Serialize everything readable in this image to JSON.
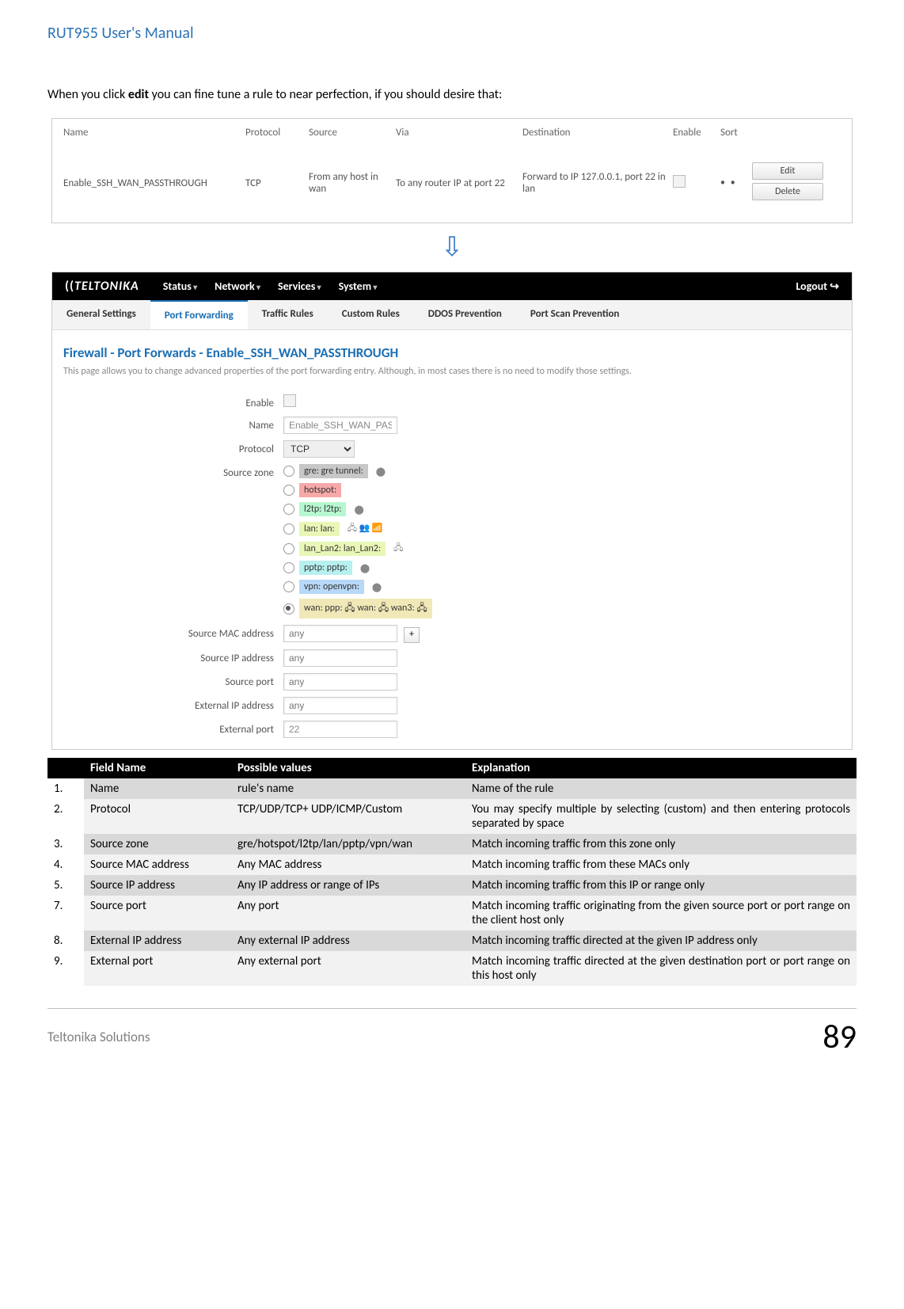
{
  "doc": {
    "header": "RUT955 User's Manual",
    "intro_prefix": "When you click ",
    "intro_bold": "edit",
    "intro_suffix": " you can fine tune a rule to near perfection, if you should desire that:",
    "footer_left": "Teltonika Solutions",
    "page_number": "89"
  },
  "rules_table": {
    "headers": {
      "name": "Name",
      "protocol": "Protocol",
      "source": "Source",
      "via": "Via",
      "destination": "Destination",
      "enable": "Enable",
      "sort": "Sort"
    },
    "row": {
      "name": "Enable_SSH_WAN_PASSTHROUGH",
      "protocol": "TCP",
      "source": "From any host in wan",
      "via": "To any router IP at port 22",
      "destination": "Forward to IP 127.0.0.1, port 22 in lan",
      "sort_dots": "• •",
      "edit": "Edit",
      "delete": "Delete"
    }
  },
  "nav": {
    "logo": "TELTONIKA",
    "menu": [
      "Status",
      "Network",
      "Services",
      "System"
    ],
    "logout": "Logout"
  },
  "tabs": [
    "General Settings",
    "Port Forwarding",
    "Traffic Rules",
    "Custom Rules",
    "DDOS Prevention",
    "Port Scan Prevention"
  ],
  "pf": {
    "title": "Firewall - Port Forwards - Enable_SSH_WAN_PASSTHROUGH",
    "note": "This page allows you to change advanced properties of the port forwarding entry. Although, in most cases there is no need to modify those settings.",
    "labels": {
      "enable": "Enable",
      "name": "Name",
      "protocol": "Protocol",
      "source_zone": "Source zone",
      "source_mac": "Source MAC address",
      "source_ip": "Source IP address",
      "source_port": "Source port",
      "ext_ip": "External IP address",
      "ext_port": "External port"
    },
    "values": {
      "name": "Enable_SSH_WAN_PASS",
      "protocol": "TCP",
      "source_mac": "any",
      "source_ip": "any",
      "source_port": "any",
      "ext_ip": "any",
      "ext_port": "22"
    },
    "zones": [
      {
        "label": "gre: gre tunnel:",
        "cls": "z-gre",
        "checked": false,
        "icons": "⬤"
      },
      {
        "label": "hotspot:",
        "cls": "z-hotspot",
        "checked": false,
        "icons": ""
      },
      {
        "label": "l2tp: l2tp:",
        "cls": "z-l2tp",
        "checked": false,
        "icons": "⬤"
      },
      {
        "label": "lan: lan:",
        "cls": "z-lan",
        "checked": false,
        "icons": "🖧 👥 📶"
      },
      {
        "label": "lan_Lan2: lan_Lan2:",
        "cls": "z-lan2",
        "checked": false,
        "icons": "🖧"
      },
      {
        "label": "pptp: pptp:",
        "cls": "z-pptp",
        "checked": false,
        "icons": "⬤"
      },
      {
        "label": "vpn: openvpn:",
        "cls": "z-vpn",
        "checked": false,
        "icons": "⬤"
      },
      {
        "label": "wan: ppp: 🖧 wan: 🖧 wan3: 🖧",
        "cls": "z-wan",
        "checked": true,
        "icons": ""
      }
    ]
  },
  "exp": {
    "headers": {
      "field": "Field Name",
      "possible": "Possible values",
      "explanation": "Explanation"
    },
    "rows": [
      {
        "n": "1.",
        "f": "Name",
        "p": "rule's name",
        "e": "Name of the rule"
      },
      {
        "n": "2.",
        "f": "Protocol",
        "p": "TCP/UDP/TCP+ UDP/ICMP/Custom",
        "e": "You may specify multiple by selecting (custom) and then entering protocols separated by space"
      },
      {
        "n": "3.",
        "f": "Source zone",
        "p": "gre/hotspot/l2tp/lan/pptp/vpn/wan",
        "e": "Match incoming traffic from this zone only"
      },
      {
        "n": "4.",
        "f": "Source MAC address",
        "p": "Any MAC address",
        "e": "Match incoming traffic from these MACs only"
      },
      {
        "n": "5.",
        "f": "Source IP address",
        "p": "Any IP address or range of IPs",
        "e": "Match incoming traffic from this IP or range only"
      },
      {
        "n": "7.",
        "f": "Source port",
        "p": "Any port",
        "e": "Match incoming traffic originating from the given source port or port range on the client host only"
      },
      {
        "n": "8.",
        "f": "External IP address",
        "p": "Any external IP address",
        "e": "Match incoming traffic directed at the given IP address only"
      },
      {
        "n": "9.",
        "f": "External port",
        "p": "Any external port",
        "e": "Match incoming traffic directed at the given destination port or port range on this host only"
      }
    ]
  }
}
